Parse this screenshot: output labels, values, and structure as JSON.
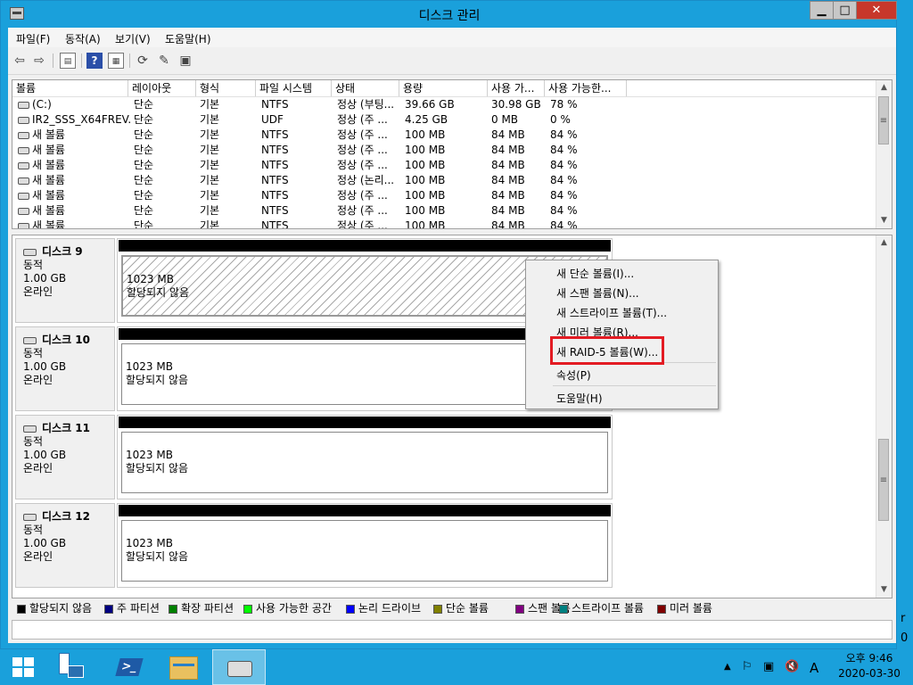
{
  "window": {
    "title": "디스크 관리",
    "min": "▁",
    "max": "□",
    "close": "✕"
  },
  "menu": [
    "파일(F)",
    "동작(A)",
    "보기(V)",
    "도움말(H)"
  ],
  "toolbar_icons": [
    "back-arrow-icon",
    "forward-arrow-icon",
    "show-hide-tree-icon",
    "help-icon",
    "properties-icon",
    "refresh-icon",
    "settings-icon",
    "export-icon"
  ],
  "volume_list": {
    "columns": [
      "볼륨",
      "레이아웃",
      "형식",
      "파일 시스템",
      "상태",
      "용량",
      "사용 가...",
      "사용 가능한..."
    ],
    "rows": [
      [
        "(C:)",
        "단순",
        "기본",
        "NTFS",
        "정상 (부팅...",
        "39.66 GB",
        "30.98 GB",
        "78 %"
      ],
      [
        "IR2_SSS_X64FREV...",
        "단순",
        "기본",
        "UDF",
        "정상 (주 ...",
        "4.25 GB",
        "0 MB",
        "0 %"
      ],
      [
        "새 볼륨",
        "단순",
        "기본",
        "NTFS",
        "정상 (주 ...",
        "100 MB",
        "84 MB",
        "84 %"
      ],
      [
        "새 볼륨",
        "단순",
        "기본",
        "NTFS",
        "정상 (주 ...",
        "100 MB",
        "84 MB",
        "84 %"
      ],
      [
        "새 볼륨",
        "단순",
        "기본",
        "NTFS",
        "정상 (주 ...",
        "100 MB",
        "84 MB",
        "84 %"
      ],
      [
        "새 볼륨",
        "단순",
        "기본",
        "NTFS",
        "정상 (논리...",
        "100 MB",
        "84 MB",
        "84 %"
      ],
      [
        "새 볼륨",
        "단순",
        "기본",
        "NTFS",
        "정상 (주 ...",
        "100 MB",
        "84 MB",
        "84 %"
      ],
      [
        "새 볼륨",
        "단순",
        "기본",
        "NTFS",
        "정상 (주 ...",
        "100 MB",
        "84 MB",
        "84 %"
      ],
      [
        "새 볼륨",
        "단순",
        "기본",
        "NTFS",
        "정상 (주 ...",
        "100 MB",
        "84 MB",
        "84 %"
      ]
    ]
  },
  "disks": [
    {
      "name": "디스크 9",
      "type": "동적",
      "size": "1.00 GB",
      "status": "온라인",
      "part_size": "1023 MB",
      "part_status": "할당되지 않음",
      "selected": true
    },
    {
      "name": "디스크 10",
      "type": "동적",
      "size": "1.00 GB",
      "status": "온라인",
      "part_size": "1023 MB",
      "part_status": "할당되지 않음",
      "selected": false
    },
    {
      "name": "디스크 11",
      "type": "동적",
      "size": "1.00 GB",
      "status": "온라인",
      "part_size": "1023 MB",
      "part_status": "할당되지 않음",
      "selected": false
    },
    {
      "name": "디스크 12",
      "type": "동적",
      "size": "1.00 GB",
      "status": "온라인",
      "part_size": "1023 MB",
      "part_status": "할당되지 않음",
      "selected": false
    }
  ],
  "context_menu": {
    "items": [
      "새 단순 볼륨(I)...",
      "새 스팬 볼륨(N)...",
      "새 스트라이프 볼륨(T)...",
      "새 미러 볼륨(R)...",
      "새 RAID-5 볼륨(W)...",
      "속성(P)",
      "도움말(H)"
    ],
    "highlighted": "새 RAID-5 볼륨(W)..."
  },
  "legend": [
    {
      "label": "할당되지 않음",
      "color": "#000000"
    },
    {
      "label": "주 파티션",
      "color": "#000080"
    },
    {
      "label": "확장 파티션",
      "color": "#008000"
    },
    {
      "label": "사용 가능한 공간",
      "color": "#00ff00"
    },
    {
      "label": "논리 드라이브",
      "color": "#0000ff"
    },
    {
      "label": "단순 볼륨",
      "color": "#808000"
    },
    {
      "label": "스팬 볼륨",
      "color": "#800080"
    },
    {
      "label": "스트라이프 볼륨",
      "color": "#008080"
    },
    {
      "label": "미러 볼륨",
      "color": "#800000"
    }
  ],
  "taskbar": {
    "buttons": [
      "start-button",
      "server-manager-button",
      "powershell-button",
      "file-explorer-button",
      "disk-management-button"
    ],
    "tray_ime": "A",
    "clock_time": "오후 9:46",
    "clock_date": "2020-03-30"
  },
  "edge_text": [
    "r",
    "0"
  ]
}
